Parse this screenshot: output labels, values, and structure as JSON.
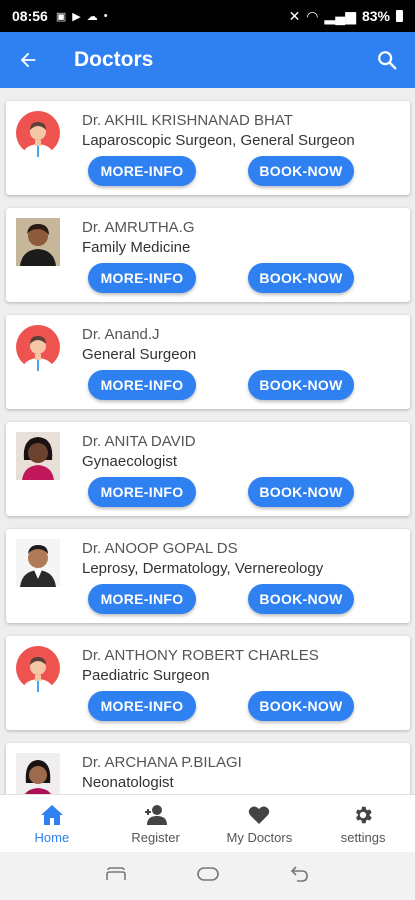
{
  "status_bar": {
    "time": "08:56",
    "battery": "83%",
    "dot": "•"
  },
  "app_bar": {
    "title": "Doctors"
  },
  "buttons": {
    "more_info": "MORE-INFO",
    "book_now": "BOOK-NOW"
  },
  "doctors": [
    {
      "name": "Dr. AKHIL KRISHNANAD BHAT",
      "specialty": "Laparoscopic Surgeon, General Surgeon",
      "avatar": "default-doctor-avatar"
    },
    {
      "name": "Dr. AMRUTHA.G",
      "specialty": "Family Medicine",
      "avatar": "photo"
    },
    {
      "name": "Dr. Anand.J",
      "specialty": "General Surgeon",
      "avatar": "default-doctor-avatar"
    },
    {
      "name": "Dr. ANITA DAVID",
      "specialty": "Gynaecologist",
      "avatar": "photo"
    },
    {
      "name": "Dr. ANOOP GOPAL DS",
      "specialty": "Leprosy, Dermatology, Vernereology",
      "avatar": "photo"
    },
    {
      "name": "Dr. ANTHONY ROBERT CHARLES",
      "specialty": "Paediatric Surgeon",
      "avatar": "default-doctor-avatar"
    },
    {
      "name": "Dr. ARCHANA P.BILAGI",
      "specialty": "Neonatologist",
      "avatar": "photo"
    }
  ],
  "bottom_nav": [
    {
      "label": "Home",
      "icon": "home-icon",
      "active": true
    },
    {
      "label": "Register",
      "icon": "add-user-icon",
      "active": false
    },
    {
      "label": "My Doctors",
      "icon": "heart-icon",
      "active": false
    },
    {
      "label": "settings",
      "icon": "gear-icon",
      "active": false
    }
  ],
  "colors": {
    "primary": "#2f80f0",
    "avatar_bg": "#ef5350"
  }
}
